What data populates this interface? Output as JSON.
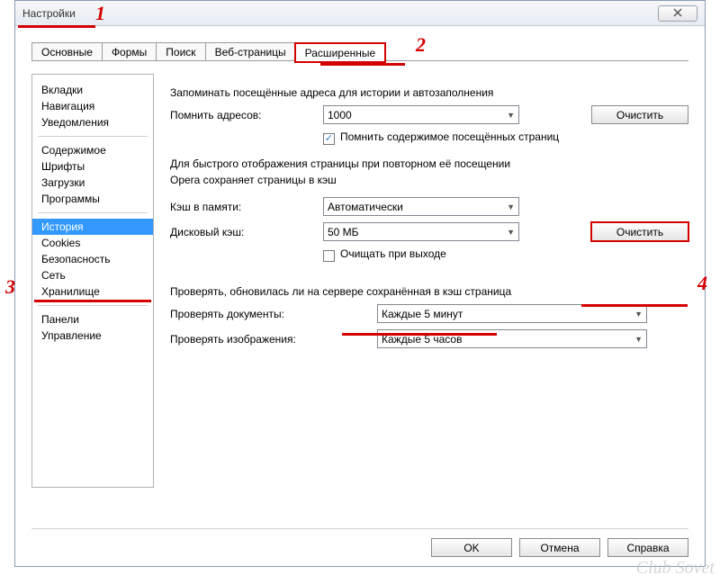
{
  "window": {
    "title": "Настройки"
  },
  "tabs": {
    "items": [
      "Основные",
      "Формы",
      "Поиск",
      "Веб-страницы",
      "Расширенные"
    ],
    "active_index": 4
  },
  "sidebar": {
    "groups": [
      [
        "Вкладки",
        "Навигация",
        "Уведомления"
      ],
      [
        "Содержимое",
        "Шрифты",
        "Загрузки",
        "Программы"
      ],
      [
        "История",
        "Cookies",
        "Безопасность",
        "Сеть",
        "Хранилище"
      ],
      [
        "Панели",
        "Управление"
      ]
    ],
    "selected": "История"
  },
  "content": {
    "heading1": "Запоминать посещённые адреса для истории и автозаполнения",
    "remember_label": "Помнить адресов:",
    "remember_value": "1000",
    "clear1_label": "Очистить",
    "remember_content_chk_label": "Помнить содержимое посещённых страниц",
    "remember_content_chk_checked": true,
    "cache_text1": "Для быстрого отображения страницы при повторном её посещении",
    "cache_text2": "Opera сохраняет страницы в кэш",
    "mem_cache_label": "Кэш в памяти:",
    "mem_cache_value": "Автоматически",
    "disk_cache_label": "Дисковый кэш:",
    "disk_cache_value": "50 МБ",
    "clear2_label": "Очистить",
    "clear_on_exit_chk_label": "Очищать при выходе",
    "clear_on_exit_chk_checked": false,
    "check_heading": "Проверять, обновилась ли на сервере сохранённая в кэш страница",
    "check_docs_label": "Проверять документы:",
    "check_docs_value": "Каждые 5 минут",
    "check_imgs_label": "Проверять изображения:",
    "check_imgs_value": "Каждые 5 часов"
  },
  "footer": {
    "ok": "OK",
    "cancel": "Отмена",
    "help": "Справка"
  },
  "annotations": {
    "a1": "1",
    "a2": "2",
    "a3": "3",
    "a4": "4"
  },
  "watermark": "Club Sovet"
}
